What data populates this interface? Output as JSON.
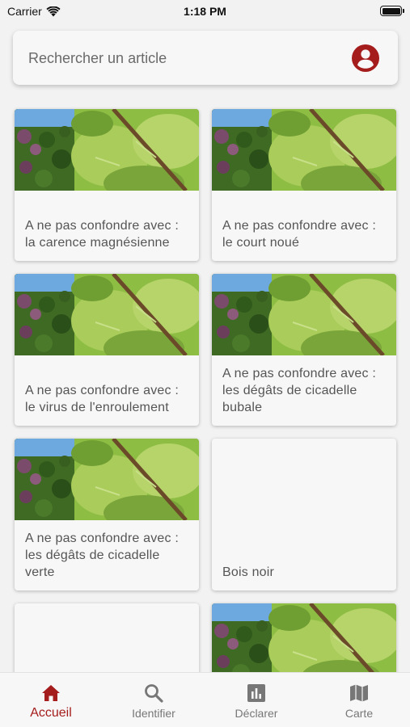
{
  "status_bar": {
    "carrier": "Carrier",
    "time": "1:18 PM",
    "battery_level": 1.0
  },
  "search": {
    "placeholder": "Rechercher un article",
    "account_icon": "account-circle-icon",
    "accent_color": "#a51c1c"
  },
  "articles": [
    {
      "title": "A ne pas confondre avec : la carence magnésienne",
      "has_image": true
    },
    {
      "title": "A ne pas confondre avec : le court noué",
      "has_image": true
    },
    {
      "title": "A ne pas confondre avec : le virus de l'enroulement",
      "has_image": true
    },
    {
      "title": "A ne pas confondre avec : les dégâts de cicadelle bubale",
      "has_image": true
    },
    {
      "title": "A ne pas confondre avec : les dégâts de cicadelle verte",
      "has_image": true
    },
    {
      "title": "Bois noir",
      "has_image": false
    },
    {
      "title": "",
      "has_image": false
    },
    {
      "title": "",
      "has_image": true
    }
  ],
  "bottom_nav": {
    "items": [
      {
        "label": "Accueil",
        "icon": "home-icon",
        "active": true
      },
      {
        "label": "Identifier",
        "icon": "search-icon",
        "active": false
      },
      {
        "label": "Déclarer",
        "icon": "bar-chart-icon",
        "active": false
      },
      {
        "label": "Carte",
        "icon": "map-icon",
        "active": false
      }
    ],
    "active_color": "#a51c1c",
    "inactive_color": "#777777"
  }
}
